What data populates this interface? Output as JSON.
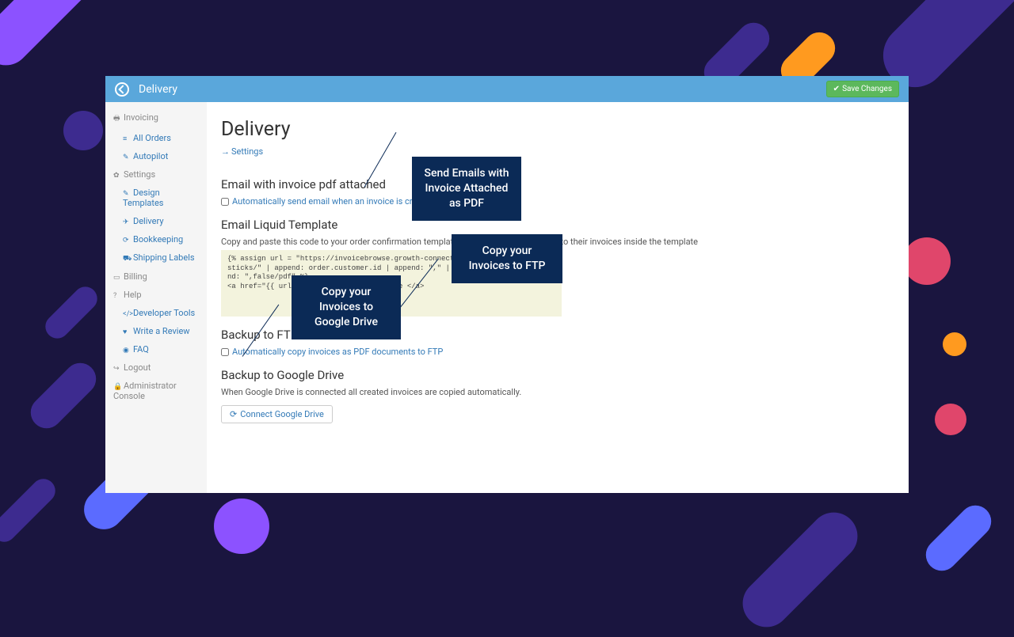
{
  "header": {
    "title": "Delivery",
    "save_label": "Save Changes"
  },
  "sidebar": {
    "invoicing_label": "Invoicing",
    "all_orders": "All Orders",
    "autopilot": "Autopilot",
    "settings_label": "Settings",
    "design_templates": "Design Templates",
    "delivery": "Delivery",
    "bookkeeping": "Bookkeeping",
    "shipping_labels": "Shipping Labels",
    "billing": "Billing",
    "help": "Help",
    "dev_tools": "Developer Tools",
    "write_review": "Write a Review",
    "faq": "FAQ",
    "logout": "Logout",
    "admin_console": "Administrator Console"
  },
  "main": {
    "page_title": "Delivery",
    "settings_link": "Settings",
    "section_email_title": "Email with invoice pdf attached",
    "email_checkbox_label": "Automatically send email when an invoice is created.",
    "section_template_title": "Email Liquid Template",
    "template_desc": "Copy and paste this code to your order confirmation template. Customers will see a link to their invoices inside the template",
    "code": "{% assign url = \"https://invoicebrowse.growth-connections.com/order/discountsticks/\" | append: order.customer.id | append: \",\" | append: order.id | append: \",false/pdf\" %}\n<a href=\"{{ url }}\">Download your invoice </a>",
    "section_ftp_title": "Backup to FTP",
    "ftp_checkbox_label": "Automatically copy invoices as PDF documents to FTP",
    "section_gdrive_title": "Backup to Google Drive",
    "gdrive_desc": "When Google Drive is connected all created invoices are copied automatically.",
    "connect_btn": "Connect Google Drive"
  },
  "callouts": {
    "email": "Send Emails with Invoice Attached as PDF",
    "ftp": "Copy your Invoices to FTP",
    "gdrive": "Copy your Invoices to Google Drive"
  }
}
